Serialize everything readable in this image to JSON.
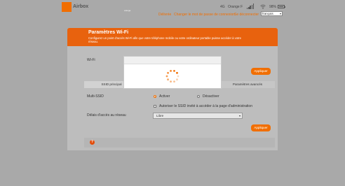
{
  "header": {
    "logo_text": "orange",
    "brand": "Airbox",
    "network_type": "4G",
    "operator": "Orange F",
    "battery": "98%",
    "battery_level": 0.98,
    "nav": {
      "item1": "Délivrée",
      "item2": "Changer le mot de passe de connexion",
      "item3": "Se déconnecter"
    },
    "language": "français"
  },
  "banner": {
    "title": "Paramètres Wi-Fi",
    "description": "Configurez un point d'accès Wi-Fi afin que votre téléphone mobile ou votre ordinateur portable puisse accéder à votre réseau."
  },
  "content": {
    "wifi_label": "Wi-Fi",
    "apply_label": "Appliquer",
    "tabs": [
      "SSID principal",
      "",
      "Paramètres avancés"
    ],
    "multi_ssid_label": "Multi-SSID",
    "activate_label": "Activer",
    "deactivate_label": "Désactiver",
    "guest_checkbox_label": "Autoriser le SSID invité à accéder à la page d'administration",
    "network_access_label": "Délais d'accès au réseau",
    "network_access_value": "Libre",
    "apply_label_2": "Appliquer",
    "help_icon": "?"
  },
  "colors": {
    "accent": "#f16e00",
    "banner": "#e8620e"
  },
  "icons": {
    "signal": "signal-bars-icon",
    "wifi": "wifi-icon",
    "battery": "battery-icon",
    "spinner": "loading-spinner-icon",
    "help": "help-icon"
  }
}
